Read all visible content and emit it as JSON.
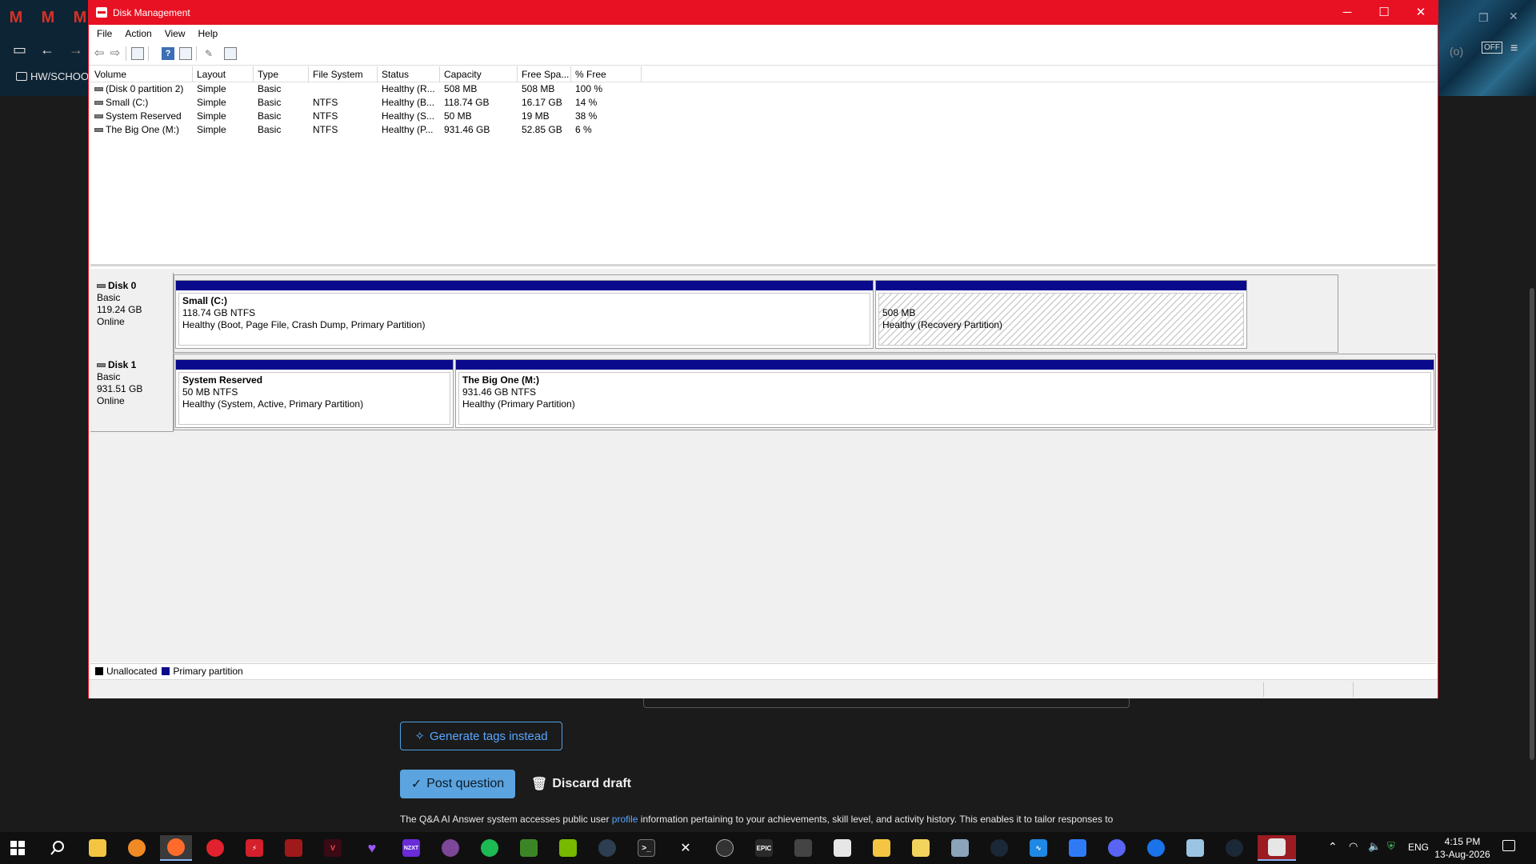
{
  "window": {
    "title": "Disk Management",
    "menu": [
      "File",
      "Action",
      "View",
      "Help"
    ]
  },
  "volume_list": {
    "columns": [
      "Volume",
      "Layout",
      "Type",
      "File System",
      "Status",
      "Capacity",
      "Free Spa...",
      "% Free"
    ],
    "rows": [
      {
        "volume": "(Disk 0 partition 2)",
        "layout": "Simple",
        "type": "Basic",
        "fs": "",
        "status": "Healthy (R...",
        "capacity": "508 MB",
        "free": "508 MB",
        "pct": "100 %"
      },
      {
        "volume": "Small (C:)",
        "layout": "Simple",
        "type": "Basic",
        "fs": "NTFS",
        "status": "Healthy (B...",
        "capacity": "118.74 GB",
        "free": "16.17 GB",
        "pct": "14 %"
      },
      {
        "volume": "System Reserved",
        "layout": "Simple",
        "type": "Basic",
        "fs": "NTFS",
        "status": "Healthy (S...",
        "capacity": "50 MB",
        "free": "19 MB",
        "pct": "38 %"
      },
      {
        "volume": "The Big One (M:)",
        "layout": "Simple",
        "type": "Basic",
        "fs": "NTFS",
        "status": "Healthy (P...",
        "capacity": "931.46 GB",
        "free": "52.85 GB",
        "pct": "6 %"
      }
    ]
  },
  "disks": [
    {
      "name": "Disk 0",
      "type": "Basic",
      "size": "119.24 GB",
      "state": "Online",
      "partitions": [
        {
          "title": "Small  (C:)",
          "size": "118.74 GB NTFS",
          "status": "Healthy (Boot, Page File, Crash Dump, Primary Partition)"
        },
        {
          "title": "",
          "size": "508 MB",
          "status": "Healthy (Recovery Partition)"
        }
      ]
    },
    {
      "name": "Disk 1",
      "type": "Basic",
      "size": "931.51 GB",
      "state": "Online",
      "partitions": [
        {
          "title": "System Reserved",
          "size": "50 MB NTFS",
          "status": "Healthy (System, Active, Primary Partition)"
        },
        {
          "title": "The Big One  (M:)",
          "size": "931.46 GB NTFS",
          "status": "Healthy (Primary Partition)"
        }
      ]
    }
  ],
  "legend": [
    {
      "label": "Unallocated",
      "color": "#000000"
    },
    {
      "label": "Primary partition",
      "color": "#0a0a8c"
    }
  ],
  "background_page": {
    "folder_label": "HW/SCHOOL",
    "generate_tags_label": "Generate tags instead",
    "post_question_label": "Post question",
    "discard_draft_label": "Discard draft",
    "footer_text_before": "The Q&A AI Answer system accesses public user ",
    "footer_link": "profile",
    "footer_text_after": " information pertaining to your achievements, skill level, and activity history. This enables it to tailor responses to"
  },
  "taskbar": {
    "apps": [
      "start-icon",
      "search-icon",
      "file-explorer-icon",
      "blender-icon",
      "firefox-icon",
      "game-launcher-icon",
      "flash-icon",
      "gpu-tool-icon",
      "valorant-icon",
      "heart-app-icon",
      "nzxt-icon",
      "tor-icon",
      "spotify-icon",
      "minecraft-icon",
      "nvidia-icon",
      "davinci-icon",
      "terminal-icon",
      "capcut-icon",
      "obs-icon",
      "epic-games-icon",
      "unity-icon",
      "notepad-icon",
      "folder-icon",
      "paint-icon",
      "installer-icon",
      "steam-icon",
      "monitor-icon",
      "roblox-icon",
      "discord-icon",
      "azure-icon",
      "disk-tool-icon",
      "steam2-icon",
      "disk-management-icon"
    ],
    "nzxt_label": "NZXT",
    "epic_label": "EPIC",
    "language": "ENG",
    "time": "4:15 PM",
    "date": "13-Aug-2026"
  },
  "colors": {
    "titlebar": "#e81123",
    "primary_partition": "#0a0a8c",
    "accent_link": "#58a6ff"
  }
}
